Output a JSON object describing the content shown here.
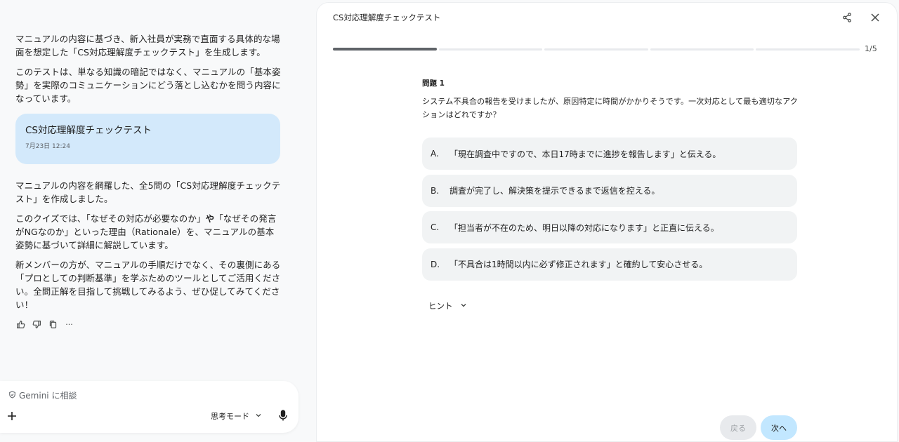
{
  "chat": {
    "paragraphs_top": [
      "マニュアルの内容に基づき、新入社員が実務で直面する具体的な場面を想定した「CS対応理解度チェックテスト」を生成します。",
      "このテストは、単なる知識の暗記ではなく、マニュアルの「基本姿勢」を実際のコミュニケーションにどう落とし込むかを問う内容になっています。"
    ],
    "artifact": {
      "title": "CS対応理解度チェックテスト",
      "date": "7月23日 12:24"
    },
    "paragraph_summary": "マニュアルの内容を網羅した、全5問の「CS対応理解度チェックテスト」を作成しました。",
    "paragraph_quiz": {
      "before": "このクイズでは、「なぜその対応が必要なのか」",
      "bold": "や",
      "after": "「なぜその発言がNGなのか」といった理由（Rationale）を、マニュアルの基本姿勢に基づいて詳細に解説しています。"
    },
    "paragraph_closing": "新メンバーの方が、マニュアルの手順だけでなく、その裏側にある「プロとしての判断基準」を学ぶためのツールとしてご活用ください。全問正解を目指して挑戦してみるよう、ぜひ促してみてください！",
    "feedback_icons": [
      "thumbs-up-icon",
      "thumbs-down-icon",
      "copy-icon",
      "more-icon"
    ],
    "more_label": "···"
  },
  "composer": {
    "placeholder": "Gemini に相談",
    "mode_label": "思考モード"
  },
  "quiz": {
    "title": "CS対応理解度チェックテスト",
    "progress": {
      "current": 1,
      "total": 5,
      "label": "1/5"
    },
    "question_number": "問題 1",
    "question_text": "システム不具合の報告を受けましたが、原因特定に時間がかかりそうです。一次対応として最も適切なアクションはどれですか？",
    "options": [
      {
        "letter": "A.",
        "text": "「現在調査中ですので、本日17時までに進捗を報告します」と伝える。"
      },
      {
        "letter": "B.",
        "text": "調査が完了し、解決策を提示できるまで返信を控える。"
      },
      {
        "letter": "C.",
        "text": "「担当者が不在のため、明日以降の対応になります」と正直に伝える。"
      },
      {
        "letter": "D.",
        "text": "「不具合は1時間以内に必ず修正されます」と確約して安心させる。"
      }
    ],
    "hint_label": "ヒント",
    "back_label": "戻る",
    "next_label": "次へ"
  },
  "colors": {
    "chip_bg": "#d3e9fb",
    "next_bg": "#c2e7ff",
    "option_bg": "#f1f3f4",
    "progress_done": "#5f6368"
  }
}
